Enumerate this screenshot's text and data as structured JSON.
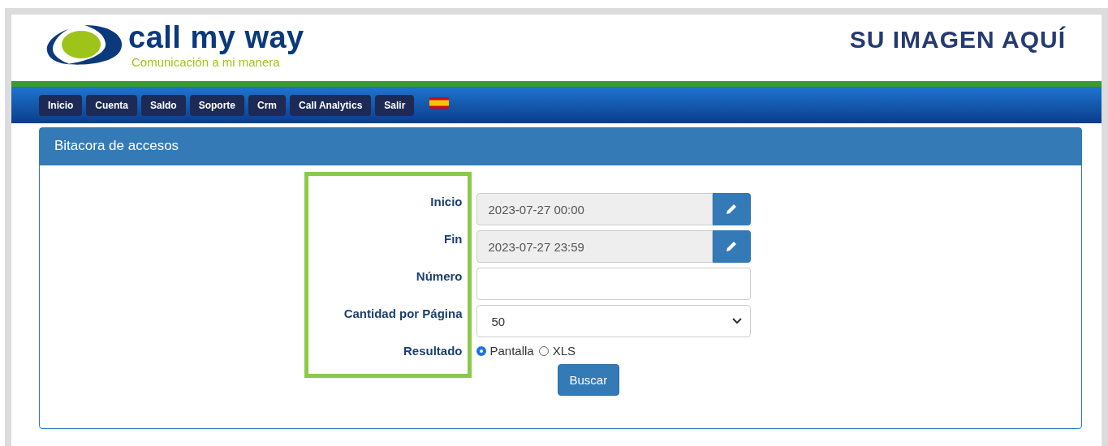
{
  "header": {
    "logo_name": "call my way",
    "tagline": "Comunicación a mi manera",
    "custom_image_text": "SU IMAGEN AQUÍ"
  },
  "nav": [
    {
      "label": "Inicio"
    },
    {
      "label": "Cuenta"
    },
    {
      "label": "Saldo"
    },
    {
      "label": "Soporte"
    },
    {
      "label": "Crm"
    },
    {
      "label": "Call Analytics"
    },
    {
      "label": "Salir"
    }
  ],
  "panel": {
    "title": "Bitacora de accesos"
  },
  "fields": [
    {
      "label": "Inicio",
      "kind": "date",
      "value": "2023-07-27 00:00"
    },
    {
      "label": "Fin",
      "kind": "date",
      "value": "2023-07-27 23:59"
    },
    {
      "label": "Número",
      "kind": "text"
    },
    {
      "label": "Cantidad por Página",
      "kind": "select",
      "value": "50"
    },
    {
      "label": "Resultado",
      "kind": "radio",
      "options": [
        {
          "label": "Pantalla",
          "selected": true
        },
        {
          "label": "XLS",
          "selected": false
        }
      ]
    }
  ],
  "submit": "Buscar"
}
